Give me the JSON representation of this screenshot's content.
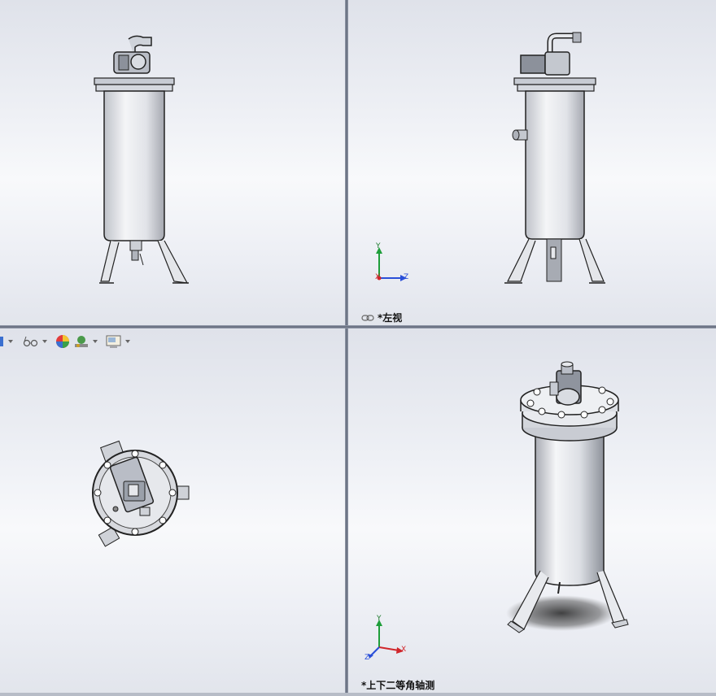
{
  "viewports": {
    "top_left": {
      "label": ""
    },
    "top_right": {
      "label": "*左视"
    },
    "bottom_left": {
      "label": ""
    },
    "bottom_right": {
      "label": "*上下二等角轴测"
    }
  },
  "triad": {
    "x": "X",
    "y": "Y",
    "z": "Z"
  },
  "toolbar": {
    "items": [
      "view-orientation",
      "hide-show-items",
      "appearance",
      "scene",
      "view-settings"
    ]
  },
  "colors": {
    "accent_red": "#d0262b",
    "accent_green": "#1e9e3a",
    "accent_blue": "#2a4fd8"
  }
}
